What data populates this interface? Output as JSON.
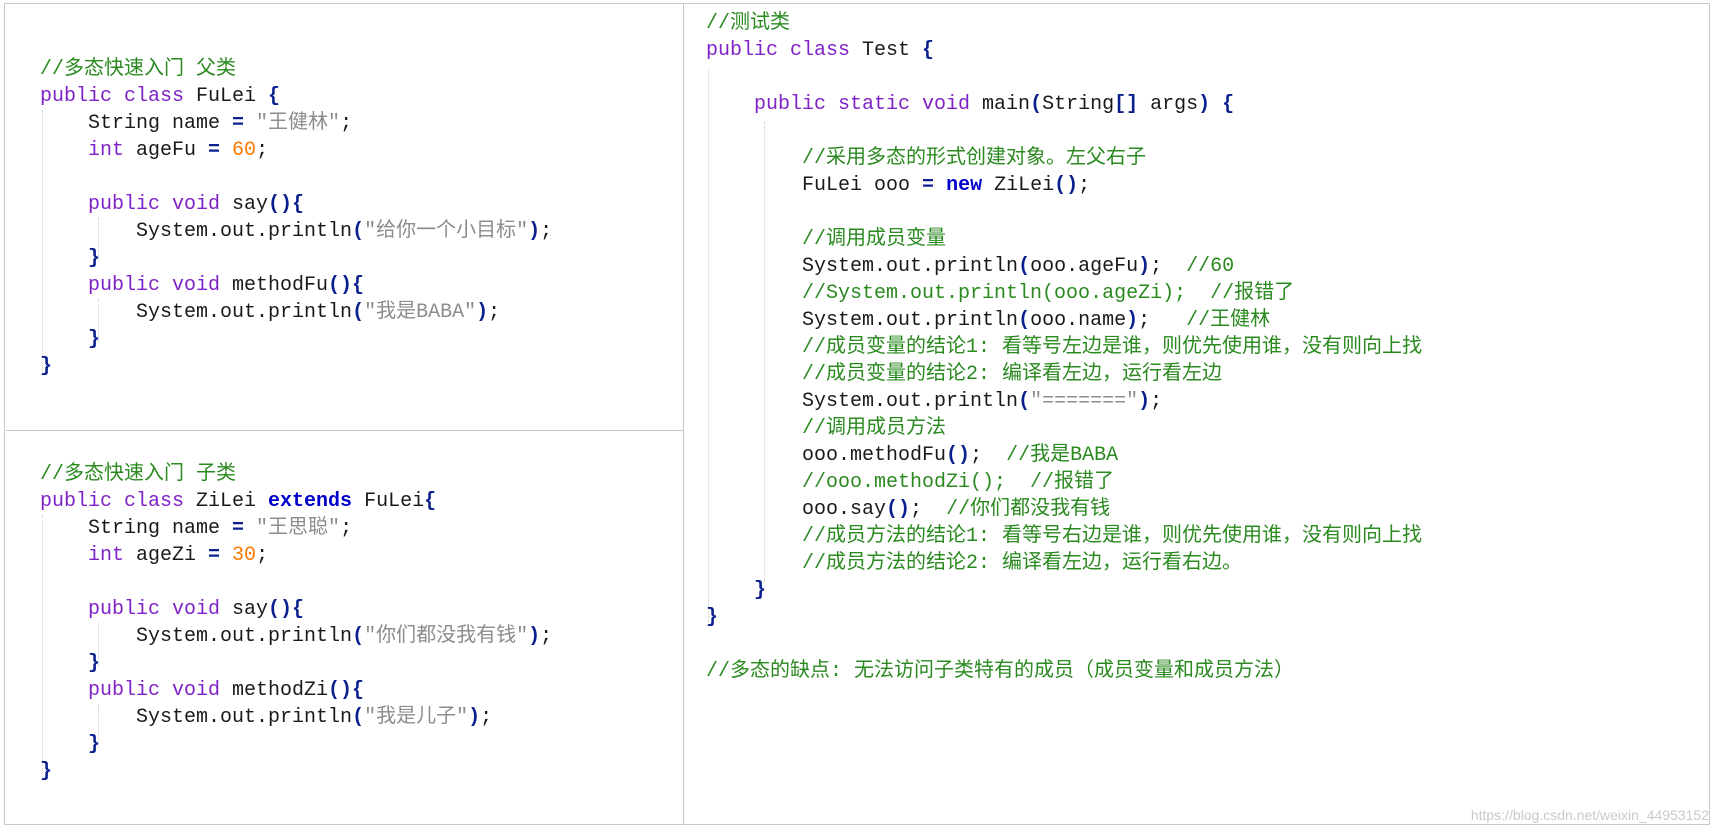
{
  "colors": {
    "keyword": "#7f22c7",
    "keyword_bold": "#0000cc",
    "comment": "#2a8a1f",
    "string": "#8c8c8c",
    "number": "#ff7a00",
    "punct": "#0b1f8f",
    "plain": "#1a1a1a"
  },
  "parent_class": {
    "lines": [
      [
        [
          "comment",
          "//多态快速入门 父类"
        ]
      ],
      [
        [
          "keyword",
          "public class "
        ],
        [
          "plain",
          "FuLei "
        ],
        [
          "punct",
          "{"
        ]
      ],
      [
        [
          "plain",
          "    String name "
        ],
        [
          "punct",
          "= "
        ],
        [
          "string",
          "\"王健林\""
        ],
        [
          "plain",
          ";"
        ]
      ],
      [
        [
          "keyword",
          "    int "
        ],
        [
          "plain",
          "ageFu "
        ],
        [
          "punct",
          "= "
        ],
        [
          "number",
          "60"
        ],
        [
          "plain",
          ";"
        ]
      ],
      [],
      [
        [
          "keyword",
          "    public void "
        ],
        [
          "plain",
          "say"
        ],
        [
          "punct",
          "(){"
        ]
      ],
      [
        [
          "plain",
          "        System.out.println"
        ],
        [
          "punct",
          "("
        ],
        [
          "string",
          "\"给你一个小目标\""
        ],
        [
          "punct",
          ")"
        ],
        [
          "plain",
          ";"
        ]
      ],
      [
        [
          "punct",
          "    }"
        ]
      ],
      [
        [
          "keyword",
          "    public void "
        ],
        [
          "plain",
          "methodFu"
        ],
        [
          "punct",
          "(){"
        ]
      ],
      [
        [
          "plain",
          "        System.out.println"
        ],
        [
          "punct",
          "("
        ],
        [
          "string",
          "\"我是BABA\""
        ],
        [
          "punct",
          ")"
        ],
        [
          "plain",
          ";"
        ]
      ],
      [
        [
          "punct",
          "    }"
        ]
      ],
      [
        [
          "punct",
          "}"
        ]
      ]
    ]
  },
  "child_class": {
    "lines": [
      [
        [
          "comment",
          "//多态快速入门 子类"
        ]
      ],
      [
        [
          "keyword",
          "public class "
        ],
        [
          "plain",
          "ZiLei "
        ],
        [
          "keyword_bold",
          "extends "
        ],
        [
          "plain",
          "FuLei"
        ],
        [
          "punct",
          "{"
        ]
      ],
      [
        [
          "plain",
          "    String name "
        ],
        [
          "punct",
          "= "
        ],
        [
          "string",
          "\"王思聪\""
        ],
        [
          "plain",
          ";"
        ]
      ],
      [
        [
          "keyword",
          "    int "
        ],
        [
          "plain",
          "ageZi "
        ],
        [
          "punct",
          "= "
        ],
        [
          "number",
          "30"
        ],
        [
          "plain",
          ";"
        ]
      ],
      [],
      [
        [
          "keyword",
          "    public void "
        ],
        [
          "plain",
          "say"
        ],
        [
          "punct",
          "(){"
        ]
      ],
      [
        [
          "plain",
          "        System.out.println"
        ],
        [
          "punct",
          "("
        ],
        [
          "string",
          "\"你们都没我有钱\""
        ],
        [
          "punct",
          ")"
        ],
        [
          "plain",
          ";"
        ]
      ],
      [
        [
          "punct",
          "    }"
        ]
      ],
      [
        [
          "keyword",
          "    public void "
        ],
        [
          "plain",
          "methodZi"
        ],
        [
          "punct",
          "(){"
        ]
      ],
      [
        [
          "plain",
          "        System.out.println"
        ],
        [
          "punct",
          "("
        ],
        [
          "string",
          "\"我是儿子\""
        ],
        [
          "punct",
          ")"
        ],
        [
          "plain",
          ";"
        ]
      ],
      [
        [
          "punct",
          "    }"
        ]
      ],
      [
        [
          "punct",
          "}"
        ]
      ]
    ]
  },
  "test_class": {
    "lines": [
      [
        [
          "comment",
          "//测试类"
        ]
      ],
      [
        [
          "keyword",
          "public class "
        ],
        [
          "plain",
          "Test "
        ],
        [
          "punct",
          "{"
        ]
      ],
      [],
      [
        [
          "keyword",
          "    public static void "
        ],
        [
          "plain",
          "main"
        ],
        [
          "punct",
          "("
        ],
        [
          "plain",
          "String"
        ],
        [
          "punct",
          "[] "
        ],
        [
          "plain",
          "args"
        ],
        [
          "punct",
          ") {"
        ]
      ],
      [],
      [
        [
          "comment",
          "        //采用多态的形式创建对象。左父右子"
        ]
      ],
      [
        [
          "plain",
          "        FuLei ooo "
        ],
        [
          "punct",
          "= "
        ],
        [
          "keyword_bold",
          "new "
        ],
        [
          "plain",
          "ZiLei"
        ],
        [
          "punct",
          "()"
        ],
        [
          "plain",
          ";"
        ]
      ],
      [],
      [
        [
          "comment",
          "        //调用成员变量"
        ]
      ],
      [
        [
          "plain",
          "        System.out.println"
        ],
        [
          "punct",
          "("
        ],
        [
          "plain",
          "ooo.ageFu"
        ],
        [
          "punct",
          ")"
        ],
        [
          "plain",
          ";  "
        ],
        [
          "comment",
          "//60"
        ]
      ],
      [
        [
          "comment",
          "        //System.out.println(ooo.ageZi);  //报错了"
        ]
      ],
      [
        [
          "plain",
          "        System.out.println"
        ],
        [
          "punct",
          "("
        ],
        [
          "plain",
          "ooo.name"
        ],
        [
          "punct",
          ")"
        ],
        [
          "plain",
          ";   "
        ],
        [
          "comment",
          "//王健林"
        ]
      ],
      [
        [
          "comment",
          "        //成员变量的结论1: 看等号左边是谁，则优先使用谁，没有则向上找"
        ]
      ],
      [
        [
          "comment",
          "        //成员变量的结论2: 编译看左边，运行看左边"
        ]
      ],
      [
        [
          "plain",
          "        System.out.println"
        ],
        [
          "punct",
          "("
        ],
        [
          "string",
          "\"=======\""
        ],
        [
          "punct",
          ")"
        ],
        [
          "plain",
          ";"
        ]
      ],
      [
        [
          "comment",
          "        //调用成员方法"
        ]
      ],
      [
        [
          "plain",
          "        ooo.methodFu"
        ],
        [
          "punct",
          "()"
        ],
        [
          "plain",
          ";  "
        ],
        [
          "comment",
          "//我是BABA"
        ]
      ],
      [
        [
          "comment",
          "        //ooo.methodZi();  //报错了"
        ]
      ],
      [
        [
          "plain",
          "        ooo.say"
        ],
        [
          "punct",
          "()"
        ],
        [
          "plain",
          ";  "
        ],
        [
          "comment",
          "//你们都没我有钱"
        ]
      ],
      [
        [
          "comment",
          "        //成员方法的结论1: 看等号右边是谁，则优先使用谁，没有则向上找"
        ]
      ],
      [
        [
          "comment",
          "        //成员方法的结论2: 编译看左边，运行看右边。"
        ]
      ],
      [
        [
          "punct",
          "    }"
        ]
      ],
      [
        [
          "punct",
          "}"
        ]
      ],
      [],
      [
        [
          "comment",
          "//多态的缺点: 无法访问子类特有的成员（成员变量和成员方法）"
        ]
      ]
    ]
  },
  "watermark": "https://blog.csdn.net/weixin_44953152"
}
